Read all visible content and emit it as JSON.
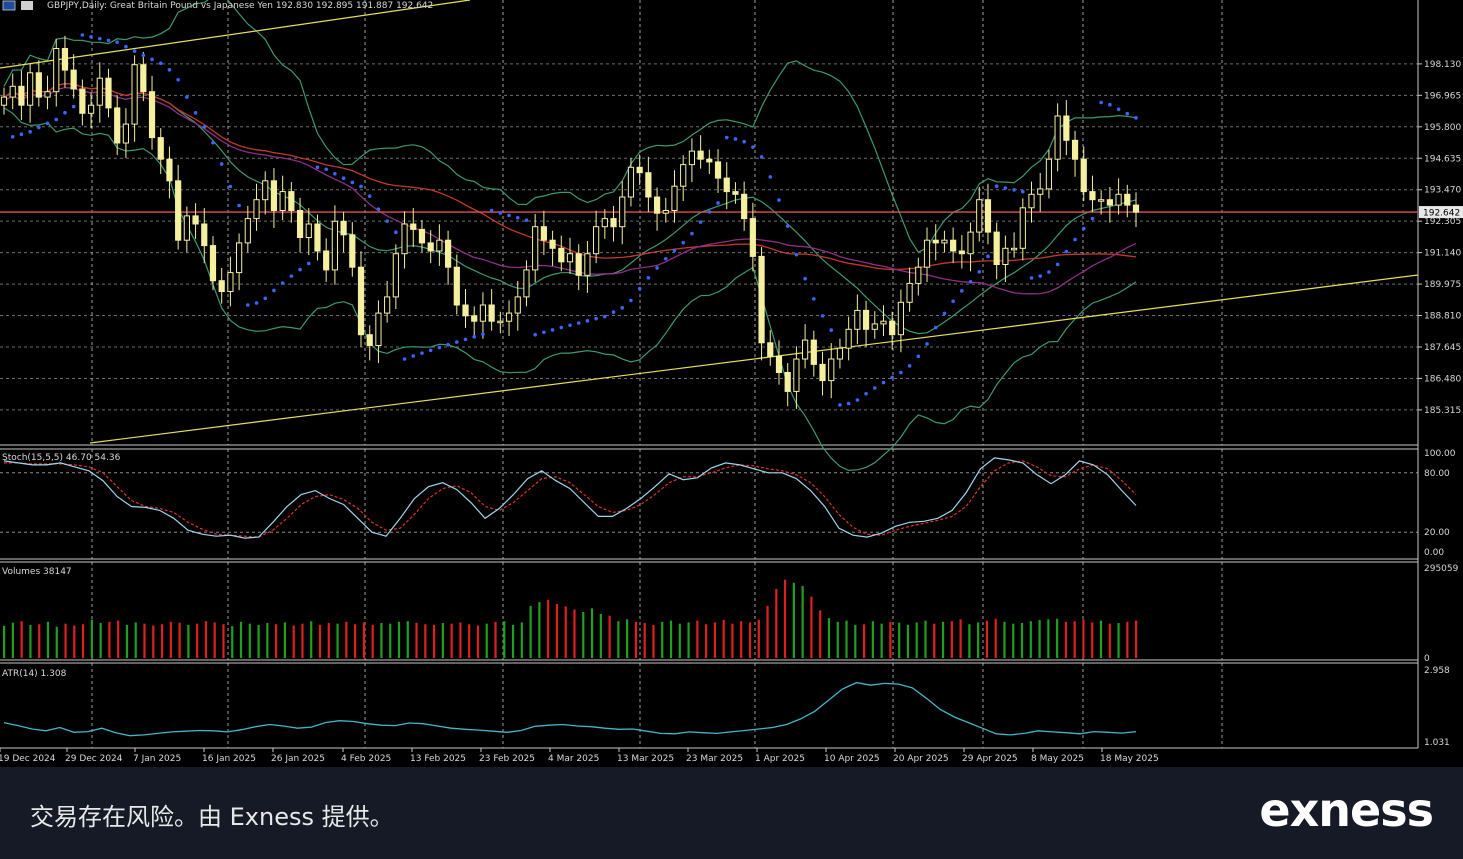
{
  "header": {
    "symbol": "GBPJPY",
    "timeframe": "Daily",
    "description": "Great Britain Pound vs Japanese Yen",
    "ohlc": "192.830 192.895 191.887 192.642"
  },
  "colors": {
    "background": "#000000",
    "grid": "#c8c8c8",
    "candle": "#f5f0a0",
    "trendline": "#e6e05a",
    "bollinger": "#3c9a6e",
    "ma_fast": "#c0392b",
    "ma_slow": "#8e2f86",
    "parabolic_sar": "#3a66ff",
    "price_line": "#e05050",
    "stoch_main": "#9fd6ee",
    "stoch_signal": "#e03030",
    "volume_up": "#20a020",
    "volume_down": "#e02020",
    "atr": "#42b6c8",
    "axis_text": "#d8d8d8"
  },
  "chart_data": [
    {
      "type": "candlestick",
      "title": "GBPJPY,Daily:  Great Britain Pound vs Japanese Yen  192.830 192.895 191.887 192.642",
      "ylim": [
        184.2,
        200.2
      ],
      "y_ticks": [
        "198.130",
        "196.965",
        "195.800",
        "194.635",
        "193.470",
        "192.305",
        "191.140",
        "189.975",
        "188.810",
        "187.645",
        "186.480",
        "185.315"
      ],
      "current_price": 192.642,
      "current_price_label": "192.642",
      "x_labels": [
        "19 Dec 2024",
        "29 Dec 2024",
        "7 Jan 2025",
        "16 Jan 2025",
        "26 Jan 2025",
        "4 Feb 2025",
        "13 Feb 2025",
        "23 Feb 2025",
        "4 Mar 2025",
        "13 Mar 2025",
        "23 Mar 2025",
        "1 Apr 2025",
        "10 Apr 2025",
        "20 Apr 2025",
        "29 Apr 2025",
        "8 May 2025",
        "18 May 2025"
      ],
      "closes": [
        196.9,
        197.3,
        196.6,
        197.8,
        196.9,
        197.1,
        198.7,
        197.9,
        197.2,
        196.3,
        196.6,
        197.6,
        196.5,
        195.2,
        195.9,
        198.1,
        197.1,
        195.4,
        194.6,
        193.8,
        191.6,
        192.5,
        192.2,
        191.4,
        190.1,
        189.7,
        190.4,
        191.5,
        192.4,
        193.1,
        193.8,
        192.7,
        193.4,
        192.7,
        191.7,
        192.2,
        191.2,
        190.5,
        192.3,
        191.8,
        190.6,
        188.1,
        187.7,
        188.9,
        189.5,
        191.1,
        192.2,
        192.0,
        191.5,
        191.2,
        191.6,
        190.6,
        189.2,
        188.8,
        188.6,
        189.2,
        188.6,
        188.6,
        188.9,
        189.5,
        190.5,
        192.1,
        191.6,
        191.3,
        190.8,
        191.1,
        190.3,
        191.1,
        192.1,
        192.4,
        192.1,
        193.2,
        194.3,
        194.1,
        193.2,
        192.6,
        192.7,
        193.6,
        194.4,
        194.9,
        194.6,
        194.5,
        193.9,
        193.4,
        193.3,
        192.4,
        191.0,
        187.8,
        187.3,
        186.7,
        186.0,
        187.2,
        187.9,
        187.0,
        186.4,
        187.2,
        187.6,
        188.3,
        189.0,
        188.3,
        188.5,
        188.6,
        188.1,
        189.3,
        190.0,
        190.6,
        191.6,
        191.5,
        191.6,
        191.2,
        191.1,
        191.9,
        193.1,
        191.9,
        190.7,
        191.3,
        191.3,
        192.8,
        193.3,
        193.5,
        194.6,
        196.2,
        195.3,
        194.6,
        193.4,
        193.1,
        193.1,
        192.9,
        193.3,
        192.9,
        192.64
      ],
      "parabolic_sar": "dots above/below price",
      "bollinger_bands": true,
      "moving_averages": 2
    },
    {
      "type": "line",
      "name": "Stoch(15,5,5)",
      "label": "Stoch(15,5,5) 46.70 54.36",
      "ylim": [
        0,
        100
      ],
      "y_ticks": [
        "100.00",
        "80.00",
        "20.00",
        "0.00"
      ],
      "main": [
        92,
        90,
        88,
        88,
        90,
        86,
        82,
        72,
        56,
        46,
        45,
        42,
        34,
        22,
        18,
        16,
        17,
        14,
        15,
        30,
        46,
        58,
        62,
        54,
        48,
        34,
        20,
        16,
        34,
        54,
        66,
        70,
        63,
        50,
        34,
        44,
        58,
        74,
        82,
        72,
        64,
        50,
        36,
        36,
        44,
        54,
        66,
        79,
        73,
        75,
        85,
        90,
        88,
        84,
        80,
        80,
        74,
        62,
        46,
        24,
        17,
        15,
        19,
        26,
        30,
        31,
        34,
        42,
        60,
        84,
        95,
        93,
        90,
        78,
        69,
        78,
        92,
        88,
        78,
        62,
        47
      ],
      "signal": [
        90,
        90,
        89,
        89,
        89,
        88,
        86,
        80,
        66,
        52,
        46,
        44,
        40,
        30,
        23,
        18,
        17,
        16,
        15,
        22,
        34,
        48,
        56,
        58,
        53,
        44,
        30,
        22,
        24,
        38,
        54,
        64,
        67,
        60,
        46,
        42,
        50,
        62,
        74,
        76,
        70,
        58,
        46,
        40,
        42,
        48,
        58,
        70,
        76,
        76,
        80,
        85,
        88,
        87,
        84,
        82,
        78,
        70,
        56,
        38,
        25,
        18,
        17,
        22,
        26,
        29,
        32,
        36,
        46,
        66,
        82,
        90,
        92,
        86,
        77,
        76,
        84,
        88,
        84,
        72,
        58
      ]
    },
    {
      "type": "bar",
      "name": "Volumes",
      "label": "Volumes 38147",
      "ylim": [
        0,
        295059
      ],
      "y_ticks": [
        "295059",
        "0"
      ],
      "up_color": "#20a020",
      "down_color": "#e02020",
      "values": [
        105,
        115,
        120,
        108,
        110,
        118,
        102,
        112,
        106,
        110,
        125,
        114,
        118,
        122,
        108,
        116,
        112,
        106,
        110,
        118,
        115,
        108,
        112,
        120,
        116,
        110,
        104,
        118,
        112,
        108,
        114,
        110,
        116,
        106,
        112,
        120,
        108,
        114,
        112,
        118,
        110,
        116,
        108,
        114,
        112,
        118,
        120,
        115,
        110,
        108,
        114,
        112,
        116,
        110,
        106,
        112,
        118,
        120,
        108,
        116,
        170,
        182,
        190,
        176,
        168,
        158,
        150,
        162,
        144,
        138,
        120,
        126,
        118,
        114,
        108,
        118,
        122,
        112,
        116,
        122,
        110,
        116,
        124,
        112,
        120,
        116,
        125,
        170,
        225,
        255,
        245,
        235,
        200,
        155,
        130,
        118,
        122,
        108,
        110,
        120,
        112,
        118,
        115,
        108,
        116,
        122,
        112,
        118,
        120,
        126,
        110,
        116,
        122,
        128,
        118,
        112,
        114,
        120,
        124,
        126,
        128,
        118,
        120,
        126,
        116,
        122,
        112,
        114,
        118,
        122
      ]
    },
    {
      "type": "line",
      "name": "ATR(14)",
      "label": "ATR(14) 1.308",
      "ylim": [
        1.031,
        2.958
      ],
      "y_ticks": [
        "2.958",
        "1.031"
      ],
      "values": [
        1.55,
        1.47,
        1.38,
        1.33,
        1.42,
        1.29,
        1.31,
        1.4,
        1.28,
        1.2,
        1.22,
        1.26,
        1.3,
        1.32,
        1.34,
        1.33,
        1.3,
        1.36,
        1.44,
        1.5,
        1.46,
        1.4,
        1.43,
        1.55,
        1.6,
        1.58,
        1.52,
        1.48,
        1.47,
        1.54,
        1.52,
        1.46,
        1.4,
        1.37,
        1.35,
        1.32,
        1.29,
        1.34,
        1.45,
        1.48,
        1.5,
        1.46,
        1.44,
        1.4,
        1.37,
        1.38,
        1.32,
        1.26,
        1.25,
        1.3,
        1.28,
        1.26,
        1.3,
        1.34,
        1.38,
        1.42,
        1.5,
        1.65,
        1.85,
        2.15,
        2.45,
        2.62,
        2.55,
        2.6,
        2.58,
        2.48,
        2.2,
        1.9,
        1.7,
        1.55,
        1.4,
        1.25,
        1.22,
        1.26,
        1.33,
        1.3,
        1.28,
        1.25,
        1.31,
        1.29,
        1.27,
        1.31
      ]
    }
  ],
  "footer": {
    "disclaimer": "交易存在风险。由 Exness 提供。",
    "logo": "exness"
  }
}
